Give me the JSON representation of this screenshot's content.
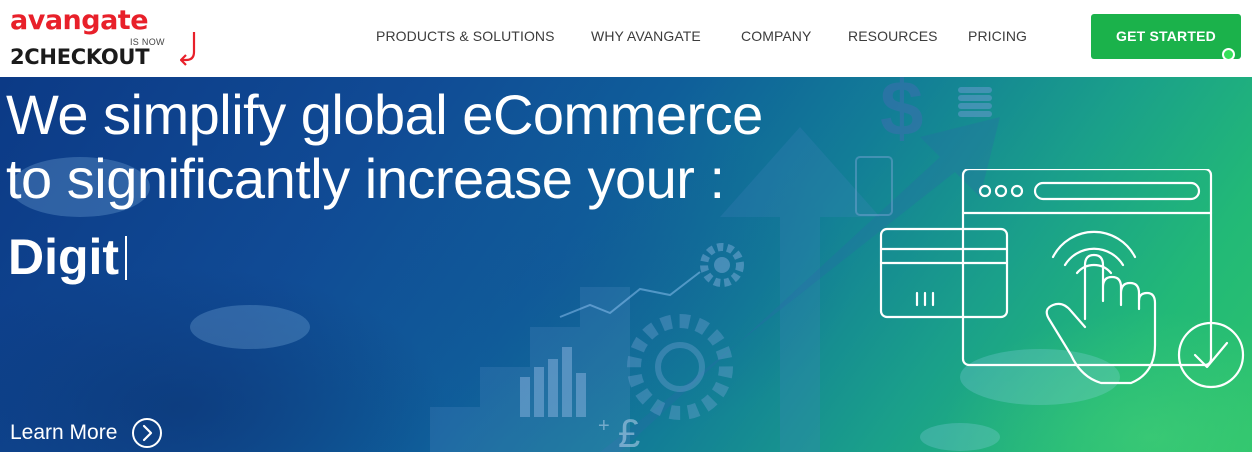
{
  "logo": {
    "top": "avangate",
    "is_now": "IS NOW",
    "bottom": "2CHECKOUT"
  },
  "nav": {
    "items": [
      {
        "label": "PRODUCTS & SOLUTIONS"
      },
      {
        "label": "WHY AVANGATE"
      },
      {
        "label": "COMPANY"
      },
      {
        "label": "RESOURCES"
      },
      {
        "label": "PRICING"
      }
    ],
    "cta": "GET STARTED"
  },
  "hero": {
    "headline_line1": "We simplify global eCommerce",
    "headline_line2": "to significantly increase your :",
    "typed_text": "Digit",
    "learn_more": "Learn More"
  },
  "colors": {
    "brand_red": "#e8202a",
    "cta_green": "#1bb24b",
    "hero_gradient_start": "#0c3a86",
    "hero_gradient_end": "#2cc36d"
  },
  "icons": {
    "learn_more": "chevron-right-circle-icon",
    "illustration": "browser-tap-card-check-icon"
  }
}
